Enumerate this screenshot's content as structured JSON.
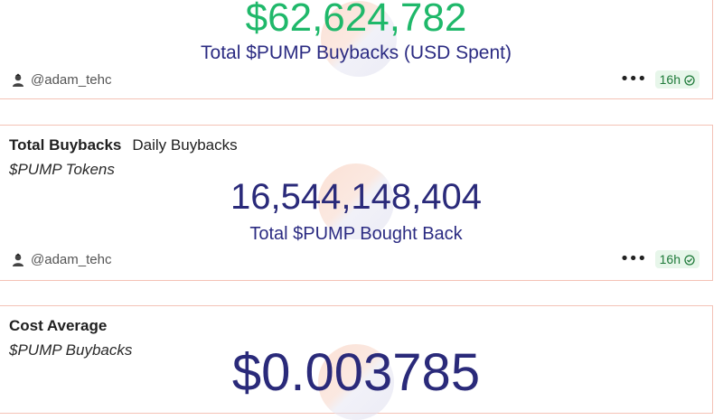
{
  "cards": [
    {
      "value": "$62,624,782",
      "value_color": "#1fb86a",
      "caption": "Total $PUMP Buybacks (USD Spent)",
      "author": "@adam_tehc",
      "time": "16h"
    },
    {
      "tab_active": "Total Buybacks",
      "tab_other": "Daily Buybacks",
      "subtitle": "$PUMP Tokens",
      "value": "16,544,148,404",
      "value_color": "#2a2a7a",
      "caption": "Total $PUMP Bought Back",
      "author": "@adam_tehc",
      "time": "16h"
    },
    {
      "tab_active": "Cost Average",
      "subtitle": "$PUMP Buybacks",
      "value": "$0.003785",
      "value_color": "#2a2a7a"
    }
  ],
  "icons": {
    "avatar": "avatar-icon",
    "more": "more-dots-icon",
    "verified": "check-circle-icon"
  },
  "colors": {
    "border": "#f4c2b6",
    "badge_bg": "#e7f6ea",
    "badge_text": "#1f7a3a",
    "caption": "#2b2b82"
  }
}
